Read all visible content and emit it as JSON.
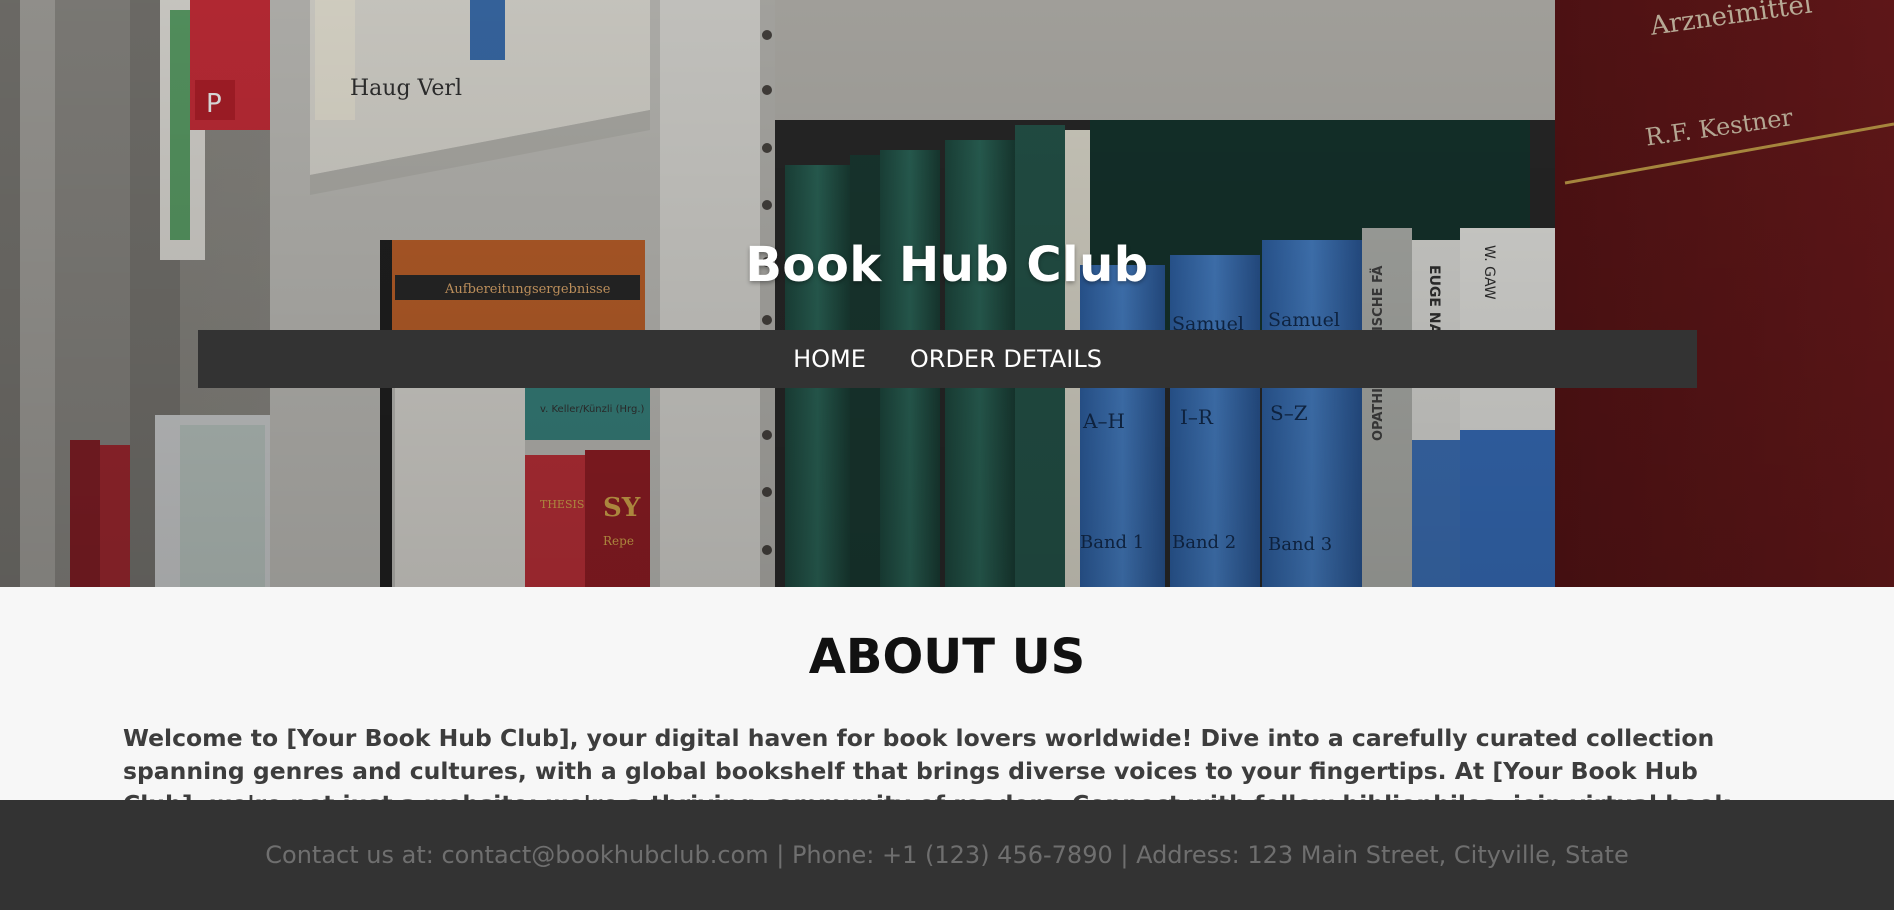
{
  "site": {
    "title": "Book Hub Club"
  },
  "nav": {
    "items": [
      {
        "label": "HOME"
      },
      {
        "label": "ORDER DETAILS"
      }
    ]
  },
  "about": {
    "heading": "ABOUT US",
    "text": "Welcome to [Your Book Hub Club], your digital haven for book lovers worldwide! Dive into a carefully curated collection spanning genres and cultures, with a global bookshelf that brings diverse voices to your fingertips. At [Your Book Hub Club], we're not just a website; we're a thriving community of readers. Connect with fellow bibliophiles, join virtual book club discussions, and explore diverse authors, genres, and stories."
  },
  "footer": {
    "text": "Contact us at: contact@bookhubclub.com | Phone: +1 (123) 456-7890 | Address: 123 Main Street, Cityville, State"
  },
  "colors": {
    "navbar": "#333333",
    "footer": "#333333",
    "page_bg": "#f7f7f7"
  },
  "hero_image": {
    "description": "bookshelf-photo"
  },
  "hero_book_lettering": [
    "Haug Verl",
    "P",
    "Aufbereitungsergebnisse",
    "v. Keller/Künzli (Hrg.)",
    "SY",
    "Repe",
    "THESIS",
    "Band 1",
    "Samuel",
    "A–H",
    "I–R",
    "S–Z",
    "Band 2",
    "Band 3",
    "EUGE NASH",
    "W. GAW",
    "OPATHIE · KLINISCHE FÄ",
    "R.F. Kestner",
    "Arzneimittel"
  ]
}
